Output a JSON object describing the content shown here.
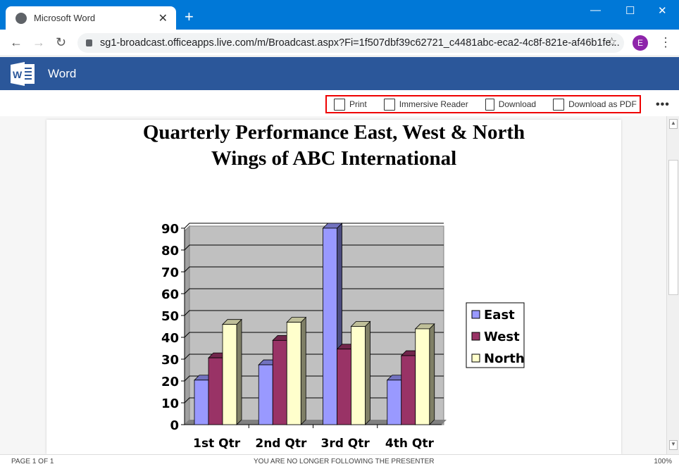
{
  "browser": {
    "tab_title": "Microsoft Word",
    "url": "sg1-broadcast.officeapps.live.com/m/Broadcast.aspx?Fi=1f507dbf39c62721_c4481abc-eca2-4c8f-821e-af46b1fe...",
    "profile_initial": "E"
  },
  "app": {
    "name": "Word"
  },
  "toolbar": {
    "print": "Print",
    "immersive_reader": "Immersive Reader",
    "download": "Download",
    "download_pdf": "Download as PDF"
  },
  "document": {
    "title_line1": "Quarterly Performance East, West & North",
    "title_line2": "Wings of ABC International"
  },
  "status": {
    "page": "PAGE 1 OF 1",
    "message": "YOU ARE NO LONGER FOLLOWING THE PRESENTER",
    "zoom": "100%"
  },
  "chart_data": {
    "type": "bar",
    "style": "3d-clustered-column",
    "categories": [
      "1st Qtr",
      "2nd Qtr",
      "3rd Qtr",
      "4th Qtr"
    ],
    "series": [
      {
        "name": "East",
        "values": [
          20.4,
          27.4,
          90,
          20.4
        ],
        "color": "#9999ff"
      },
      {
        "name": "West",
        "values": [
          30.6,
          38.6,
          34.6,
          31.6
        ],
        "color": "#993366"
      },
      {
        "name": "North",
        "values": [
          45.9,
          46.9,
          45,
          43.9
        ],
        "color": "#ffffcc"
      }
    ],
    "ylim": [
      0,
      90
    ],
    "yticks": [
      0,
      10,
      20,
      30,
      40,
      50,
      60,
      70,
      80,
      90
    ],
    "grid": true,
    "legend": "right",
    "plot_background": "#c0c0c0"
  }
}
